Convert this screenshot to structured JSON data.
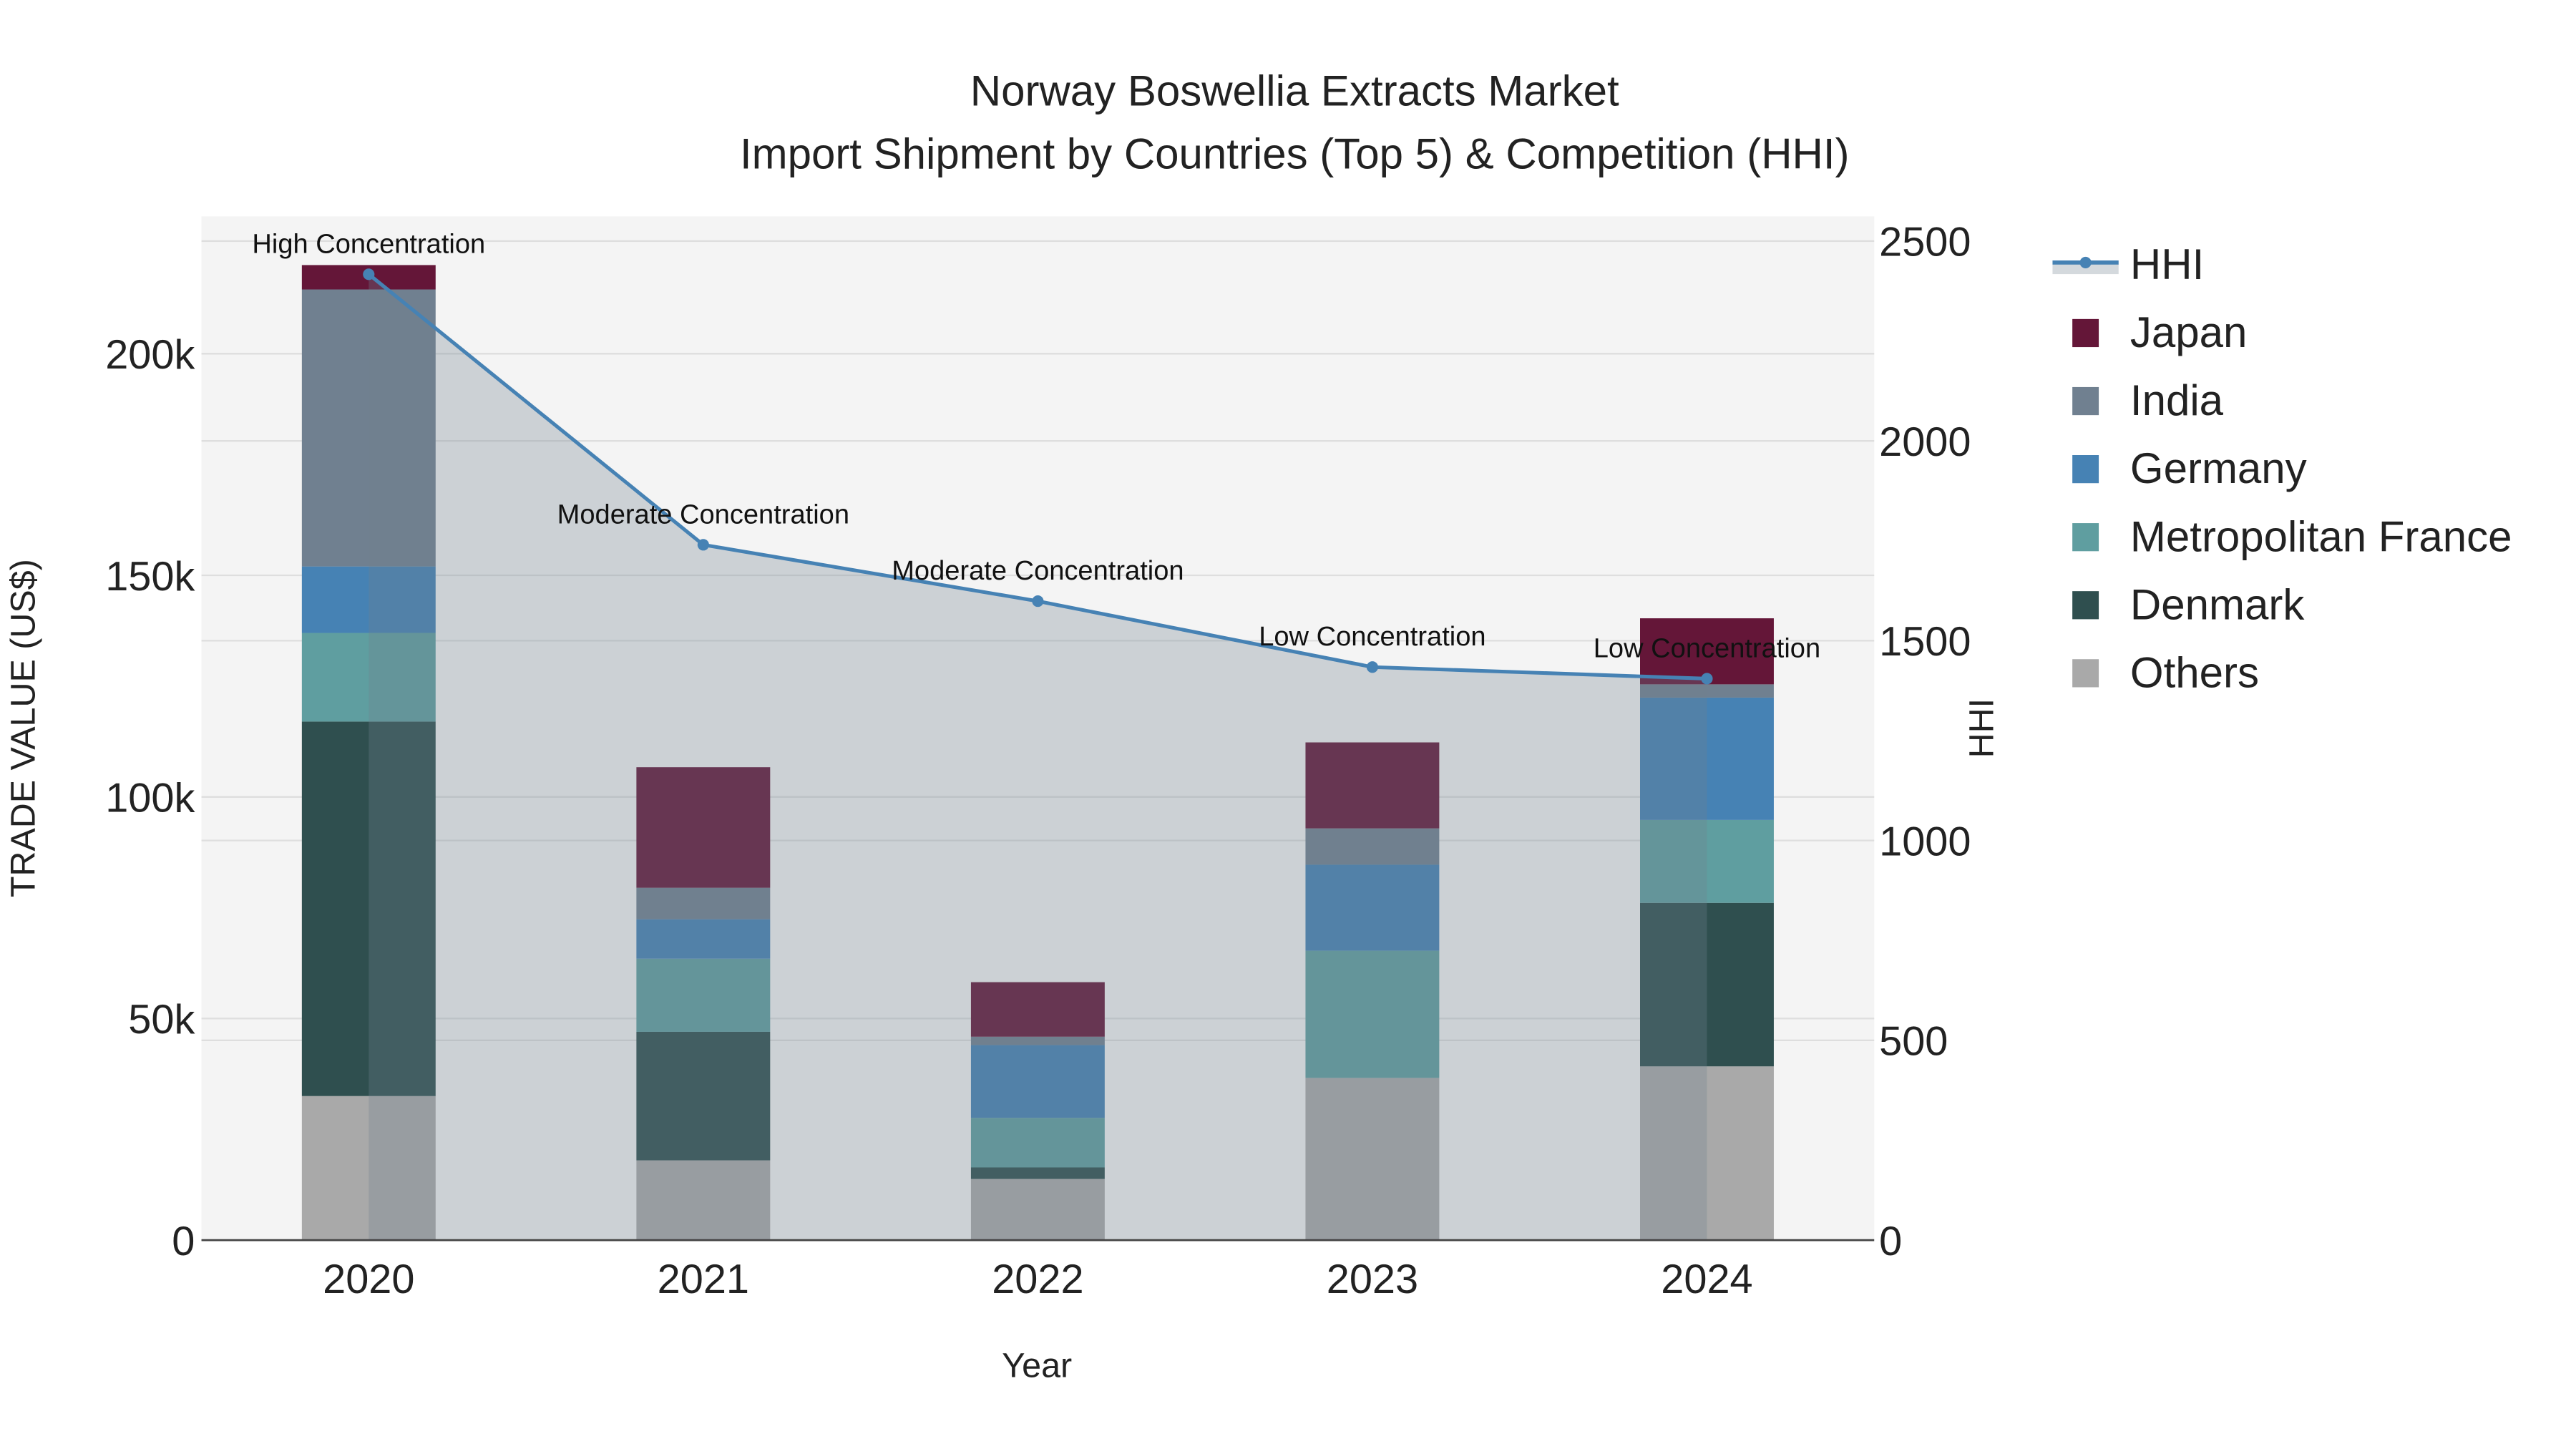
{
  "chart_data": {
    "type": "bar",
    "stacked": true,
    "title_line1": "Norway Boswellia Extracts Market",
    "title_line2": "Import Shipment by Countries (Top 5) & Competition (HHI)",
    "xlabel": "Year",
    "ylabel": "TRADE VALUE (US$)",
    "y2label": "HHI",
    "categories": [
      "2020",
      "2021",
      "2022",
      "2023",
      "2024"
    ],
    "ylim": [
      0,
      231000
    ],
    "y_ticks": [
      0,
      50000,
      100000,
      150000,
      200000
    ],
    "y_tick_labels": [
      "0",
      "50k",
      "100k",
      "150k",
      "200k"
    ],
    "y2lim": [
      0,
      2562
    ],
    "y2_ticks": [
      0,
      500,
      1000,
      1500,
      2000,
      2500
    ],
    "y2_tick_labels": [
      "0",
      "500",
      "1000",
      "1500",
      "2000",
      "2500"
    ],
    "grid": true,
    "legend_position": "right",
    "series": [
      {
        "name": "Others",
        "color": "#a9a9a9",
        "values": [
          32500,
          18000,
          13800,
          36600,
          39200
        ]
      },
      {
        "name": "Denmark",
        "color": "#2f4f4f",
        "values": [
          84500,
          29000,
          2600,
          0,
          36900
        ]
      },
      {
        "name": "Metropolitan France",
        "color": "#5f9ea0",
        "values": [
          20000,
          16500,
          11200,
          28700,
          18700
        ]
      },
      {
        "name": "Germany",
        "color": "#4682b4",
        "values": [
          15000,
          8900,
          16400,
          19400,
          27600
        ]
      },
      {
        "name": "India",
        "color": "#708090",
        "values": [
          62500,
          7100,
          1900,
          8200,
          3000
        ]
      },
      {
        "name": "Japan",
        "color": "#641638",
        "values": [
          5500,
          27200,
          12300,
          19400,
          14900
        ]
      }
    ],
    "hhi": {
      "name": "HHI",
      "color": "#4682b4",
      "values": [
        2417,
        1740,
        1599,
        1434,
        1405
      ],
      "annotations": [
        "High Concentration",
        "Moderate Concentration",
        "Moderate Concentration",
        "Low Concentration",
        "Low Concentration"
      ]
    },
    "legend_order": [
      "HHI",
      "Japan",
      "India",
      "Germany",
      "Metropolitan France",
      "Denmark",
      "Others"
    ]
  }
}
